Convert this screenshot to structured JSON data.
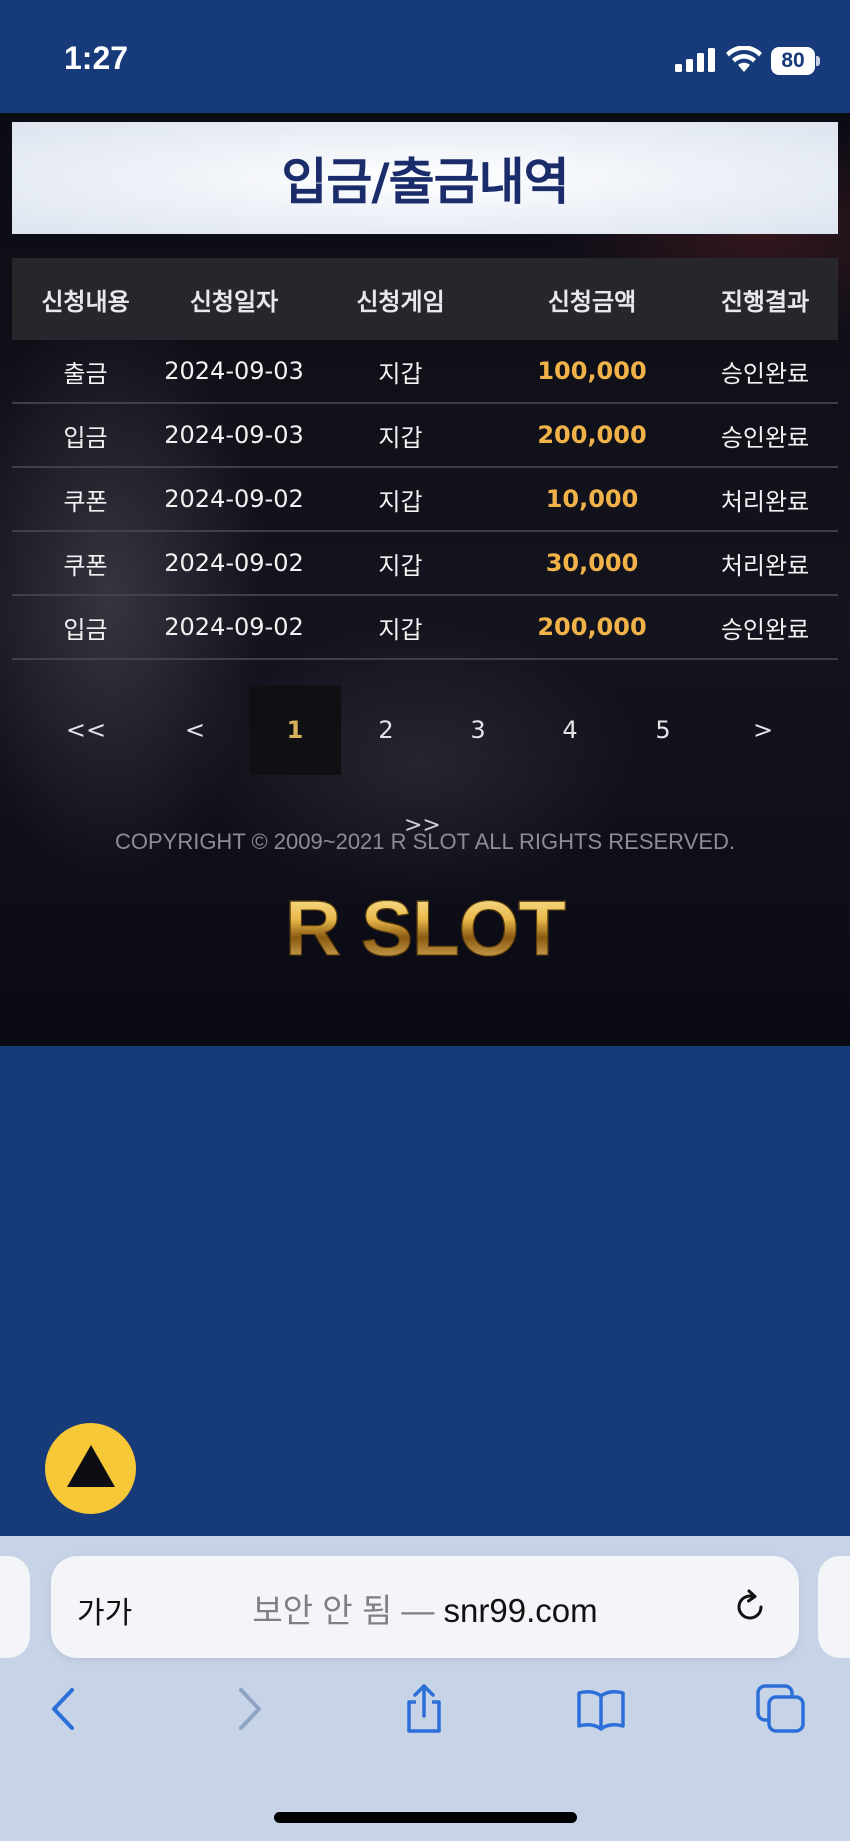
{
  "status_bar": {
    "time": "1:27",
    "battery": "80"
  },
  "page": {
    "title": "입금/출금내역"
  },
  "table": {
    "headers": [
      "신청내용",
      "신청일자",
      "신청게임",
      "신청금액",
      "진행결과"
    ],
    "rows": [
      {
        "type": "출금",
        "date": "2024-09-03",
        "game": "지갑",
        "amount": "100,000",
        "result": "승인완료"
      },
      {
        "type": "입금",
        "date": "2024-09-03",
        "game": "지갑",
        "amount": "200,000",
        "result": "승인완료"
      },
      {
        "type": "쿠폰",
        "date": "2024-09-02",
        "game": "지갑",
        "amount": "10,000",
        "result": "처리완료"
      },
      {
        "type": "쿠폰",
        "date": "2024-09-02",
        "game": "지갑",
        "amount": "30,000",
        "result": "처리완료"
      },
      {
        "type": "입금",
        "date": "2024-09-02",
        "game": "지갑",
        "amount": "200,000",
        "result": "승인완료"
      }
    ]
  },
  "pagination": {
    "first": "<<",
    "prev": "<",
    "pages": [
      "1",
      "2",
      "3",
      "4",
      "5"
    ],
    "current": "1",
    "next": ">",
    "last": ">>"
  },
  "footer": {
    "copyright": "COPYRIGHT © 2009~2021 R SLOT ALL RIGHTS RESERVED.",
    "logo": "R SLOT"
  },
  "browser": {
    "aa_label": "가가",
    "insecure_label": "보안 안 됨",
    "separator": " — ",
    "domain": "snr99.com"
  },
  "colors": {
    "amount": "#f2b24a",
    "accent_button": "#f6c737",
    "title": "#1b2c6a"
  },
  "icons": [
    "signal-icon",
    "wifi-icon",
    "reload-icon",
    "back-icon",
    "forward-icon",
    "share-icon",
    "bookmarks-icon",
    "tabs-icon",
    "scroll-top-icon"
  ]
}
